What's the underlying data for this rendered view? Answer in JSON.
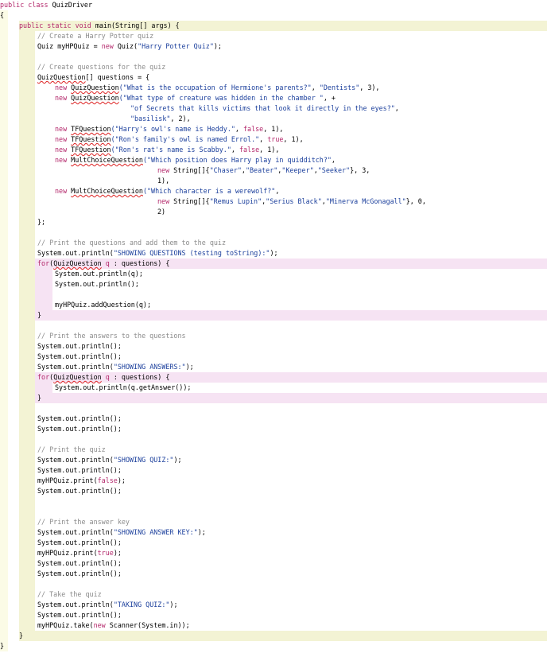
{
  "lines": [
    {
      "indent": 0,
      "parts": [
        [
          "kw",
          "public class "
        ],
        [
          "",
          "QuizDriver"
        ]
      ]
    },
    {
      "indent": 0,
      "parts": [
        [
          "",
          "{"
        ]
      ]
    },
    {
      "indent": 24,
      "parts": [
        [
          "kw",
          "public static void "
        ],
        [
          "",
          "main(String[] args) {"
        ]
      ]
    },
    {
      "indent": 47,
      "parts": [
        [
          "cm",
          "// Create a Harry Potter quiz"
        ]
      ]
    },
    {
      "indent": 47,
      "parts": [
        [
          "",
          "Quiz myHPQuiz = "
        ],
        [
          "kw",
          "new "
        ],
        [
          "",
          "Quiz("
        ],
        [
          "st",
          "\"Harry Potter Quiz\""
        ],
        [
          "",
          ");"
        ]
      ]
    },
    {
      "indent": 47,
      "parts": [
        [
          "",
          ""
        ]
      ]
    },
    {
      "indent": 47,
      "parts": [
        [
          "cm",
          "// Create questions for the quiz"
        ]
      ]
    },
    {
      "indent": 47,
      "parts": [
        [
          "err",
          "QuizQuestion"
        ],
        [
          "",
          "[] questions = {"
        ]
      ]
    },
    {
      "indent": 69,
      "parts": [
        [
          "kw",
          "new "
        ],
        [
          "err",
          "QuizQuestion"
        ],
        [
          "st",
          "(\"What is the occupation of Hermione's parents?\""
        ],
        [
          "",
          ", "
        ],
        [
          "st",
          "\"Dentists\""
        ],
        [
          "",
          ", 3),"
        ]
      ]
    },
    {
      "indent": 69,
      "parts": [
        [
          "kw",
          "new "
        ],
        [
          "err",
          "QuizQuestion"
        ],
        [
          "st",
          "(\"What type of creature was hidden in the chamber \""
        ],
        [
          "",
          ", +"
        ]
      ]
    },
    {
      "indent": 164,
      "parts": [
        [
          "st",
          "\"of Secrets that kills victims that look it directly in the eyes?\""
        ],
        [
          "",
          ","
        ]
      ]
    },
    {
      "indent": 164,
      "parts": [
        [
          "st",
          "\"basilisk\""
        ],
        [
          "",
          ", 2),"
        ]
      ]
    },
    {
      "indent": 69,
      "parts": [
        [
          "kw",
          "new "
        ],
        [
          "err",
          "TFQuestion"
        ],
        [
          "st",
          "(\"Harry's owl's name is Heddy.\""
        ],
        [
          "",
          ", "
        ],
        [
          "kw",
          "false"
        ],
        [
          "",
          ", 1),"
        ]
      ]
    },
    {
      "indent": 69,
      "parts": [
        [
          "kw",
          "new "
        ],
        [
          "err",
          "TFQuestion"
        ],
        [
          "st",
          "(\"Ron's family's owl is named Errol.\""
        ],
        [
          "",
          ", "
        ],
        [
          "kw",
          "true"
        ],
        [
          "",
          ", 1),"
        ]
      ]
    },
    {
      "indent": 69,
      "parts": [
        [
          "kw",
          "new "
        ],
        [
          "err",
          "TFQuestion"
        ],
        [
          "st",
          "(\"Ron's rat's name is Scabby.\""
        ],
        [
          "",
          ", "
        ],
        [
          "kw",
          "false"
        ],
        [
          "",
          ", 1),"
        ]
      ]
    },
    {
      "indent": 69,
      "parts": [
        [
          "kw",
          "new "
        ],
        [
          "err",
          "MultChoiceQuestion"
        ],
        [
          "st",
          "(\"Which position does Harry play in quidditch?\""
        ],
        [
          "",
          ","
        ]
      ]
    },
    {
      "indent": 198,
      "parts": [
        [
          "kw",
          "new "
        ],
        [
          "",
          "String[]{"
        ],
        [
          "st",
          "\"Chaser\""
        ],
        [
          "",
          ","
        ],
        [
          "st",
          "\"Beater\""
        ],
        [
          "",
          ","
        ],
        [
          "st",
          "\"Keeper\""
        ],
        [
          "",
          ","
        ],
        [
          "st",
          "\"Seeker\""
        ],
        [
          "",
          "}, 3,"
        ]
      ]
    },
    {
      "indent": 198,
      "parts": [
        [
          "",
          "1),"
        ]
      ]
    },
    {
      "indent": 69,
      "parts": [
        [
          "kw",
          "new "
        ],
        [
          "err",
          "MultChoiceQuestion"
        ],
        [
          "st",
          "(\"Which character is a werewolf?\""
        ],
        [
          "",
          ","
        ]
      ]
    },
    {
      "indent": 198,
      "parts": [
        [
          "kw",
          "new "
        ],
        [
          "",
          "String[]{"
        ],
        [
          "st",
          "\"Remus Lupin\""
        ],
        [
          "",
          ","
        ],
        [
          "st",
          "\"Serius Black\""
        ],
        [
          "",
          ","
        ],
        [
          "st",
          "\"Minerva McGonagall\""
        ],
        [
          "",
          "}, 0,"
        ]
      ]
    },
    {
      "indent": 198,
      "parts": [
        [
          "",
          "2)"
        ]
      ]
    },
    {
      "indent": 47,
      "parts": [
        [
          "",
          "};"
        ]
      ]
    },
    {
      "indent": 47,
      "parts": [
        [
          "",
          ""
        ]
      ]
    },
    {
      "indent": 47,
      "parts": [
        [
          "cm",
          "// Print the questions and add them to the quiz"
        ]
      ]
    },
    {
      "indent": 47,
      "parts": [
        [
          "",
          "System.out.println("
        ],
        [
          "st",
          "\"SHOWING QUESTIONS (testing toString):\""
        ],
        [
          "",
          ");"
        ]
      ]
    },
    {
      "indent": 47,
      "parts": [
        [
          "kw",
          "for"
        ],
        [
          "",
          "("
        ],
        [
          "err",
          "QuizQuestion"
        ],
        [
          "",
          ""
        ],
        [
          "",
          ""
        ],
        [
          "kw",
          " q "
        ],
        [
          "",
          ": questions) {"
        ]
      ]
    },
    {
      "indent": 69,
      "parts": [
        [
          "",
          "System.out.println(q);"
        ]
      ]
    },
    {
      "indent": 69,
      "parts": [
        [
          "",
          "System.out.println();"
        ]
      ]
    },
    {
      "indent": 69,
      "parts": [
        [
          "",
          ""
        ]
      ]
    },
    {
      "indent": 69,
      "parts": [
        [
          "",
          "myHPQuiz.addQuestion(q);"
        ]
      ]
    },
    {
      "indent": 47,
      "parts": [
        [
          "",
          "}"
        ]
      ]
    },
    {
      "indent": 47,
      "parts": [
        [
          "",
          ""
        ]
      ]
    },
    {
      "indent": 47,
      "parts": [
        [
          "cm",
          "// Print the answers to the questions"
        ]
      ]
    },
    {
      "indent": 47,
      "parts": [
        [
          "",
          "System.out.println();"
        ]
      ]
    },
    {
      "indent": 47,
      "parts": [
        [
          "",
          "System.out.println();"
        ]
      ]
    },
    {
      "indent": 47,
      "parts": [
        [
          "",
          "System.out.println("
        ],
        [
          "st",
          "\"SHOWING ANSWERS:\""
        ],
        [
          "",
          ");"
        ]
      ]
    },
    {
      "indent": 47,
      "parts": [
        [
          "kw",
          "for"
        ],
        [
          "",
          "("
        ],
        [
          "err",
          "QuizQuestion"
        ],
        [
          "kw",
          " q "
        ],
        [
          "",
          ": questions) {"
        ]
      ]
    },
    {
      "indent": 69,
      "parts": [
        [
          "",
          "System.out.println(q.getAnswer());"
        ]
      ]
    },
    {
      "indent": 47,
      "parts": [
        [
          "",
          "}"
        ]
      ]
    },
    {
      "indent": 47,
      "parts": [
        [
          "",
          ""
        ]
      ]
    },
    {
      "indent": 47,
      "parts": [
        [
          "",
          "System.out.println();"
        ]
      ]
    },
    {
      "indent": 47,
      "parts": [
        [
          "",
          "System.out.println();"
        ]
      ]
    },
    {
      "indent": 47,
      "parts": [
        [
          "",
          ""
        ]
      ]
    },
    {
      "indent": 47,
      "parts": [
        [
          "cm",
          "// Print the quiz"
        ]
      ]
    },
    {
      "indent": 47,
      "parts": [
        [
          "",
          "System.out.println("
        ],
        [
          "st",
          "\"SHOWING QUIZ:\""
        ],
        [
          "",
          ");"
        ]
      ]
    },
    {
      "indent": 47,
      "parts": [
        [
          "",
          "System.out.println();"
        ]
      ]
    },
    {
      "indent": 47,
      "parts": [
        [
          "",
          "myHPQuiz.print("
        ],
        [
          "kw",
          "false"
        ],
        [
          "",
          ");"
        ]
      ]
    },
    {
      "indent": 47,
      "parts": [
        [
          "",
          "System.out.println();"
        ]
      ]
    },
    {
      "indent": 47,
      "parts": [
        [
          "",
          ""
        ]
      ]
    },
    {
      "indent": 47,
      "parts": [
        [
          "",
          ""
        ]
      ]
    },
    {
      "indent": 47,
      "parts": [
        [
          "cm",
          "// Print the answer key"
        ]
      ]
    },
    {
      "indent": 47,
      "parts": [
        [
          "",
          "System.out.println("
        ],
        [
          "st",
          "\"SHOWING ANSWER KEY:\""
        ],
        [
          "",
          ");"
        ]
      ]
    },
    {
      "indent": 47,
      "parts": [
        [
          "",
          "System.out.println();"
        ]
      ]
    },
    {
      "indent": 47,
      "parts": [
        [
          "",
          "myHPQuiz.print("
        ],
        [
          "kw",
          "true"
        ],
        [
          "",
          ");"
        ]
      ]
    },
    {
      "indent": 47,
      "parts": [
        [
          "",
          "System.out.println();"
        ]
      ]
    },
    {
      "indent": 47,
      "parts": [
        [
          "",
          "System.out.println();"
        ]
      ]
    },
    {
      "indent": 47,
      "parts": [
        [
          "",
          ""
        ]
      ]
    },
    {
      "indent": 47,
      "parts": [
        [
          "cm",
          "// Take the quiz"
        ]
      ]
    },
    {
      "indent": 47,
      "parts": [
        [
          "",
          "System.out.println("
        ],
        [
          "st",
          "\"TAKING QUIZ:\""
        ],
        [
          "",
          ");"
        ]
      ]
    },
    {
      "indent": 47,
      "parts": [
        [
          "",
          "System.out.println();"
        ]
      ]
    },
    {
      "indent": 47,
      "parts": [
        [
          "",
          "myHPQuiz.take("
        ],
        [
          "kw",
          "new "
        ],
        [
          "",
          "Scanner(System.in));"
        ]
      ]
    },
    {
      "indent": 24,
      "parts": [
        [
          "",
          "}"
        ]
      ]
    },
    {
      "indent": 0,
      "parts": [
        [
          "",
          "}"
        ]
      ]
    }
  ]
}
